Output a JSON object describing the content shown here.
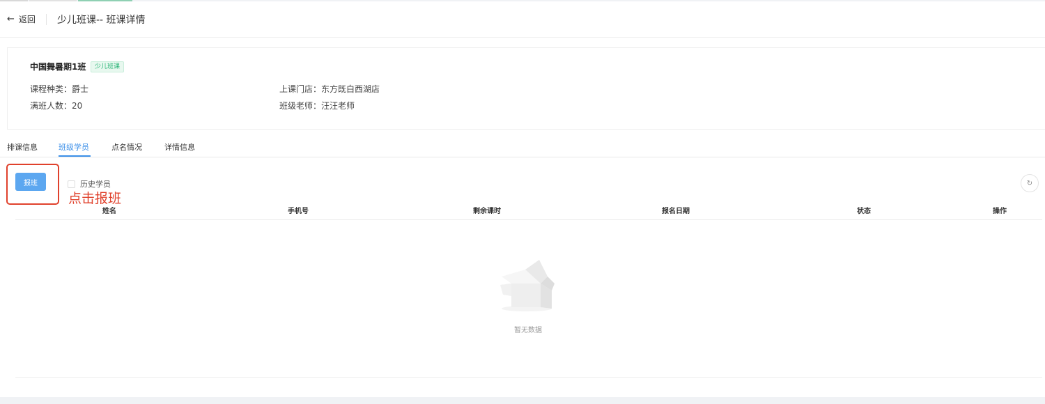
{
  "header": {
    "back_label": "返回",
    "title": "少儿班课-- 班课详情"
  },
  "class_info": {
    "name": "中国舞暑期1班",
    "tag": "少儿班课",
    "course_type": "课程种类：爵士",
    "capacity": "满班人数：20",
    "store": "上课门店：东方既白西湖店",
    "teacher": "班级老师：汪汪老师"
  },
  "tabs": [
    {
      "label": "排课信息",
      "active": false
    },
    {
      "label": "班级学员",
      "active": true
    },
    {
      "label": "点名情况",
      "active": false
    },
    {
      "label": "详情信息",
      "active": false
    }
  ],
  "toolbar": {
    "enroll_label": "报班",
    "history_label": "历史学员",
    "history_checked": false,
    "annotation": "点击报班",
    "refresh_icon": "refresh-icon"
  },
  "table": {
    "columns": [
      "姓名",
      "手机号",
      "剩余课时",
      "报名日期",
      "状态",
      "操作"
    ],
    "rows": [],
    "empty_text": "暂无数据"
  },
  "colors": {
    "accent": "#3b8fe8",
    "button": "#5ca7f0",
    "tag": "#2fb67a",
    "annotation": "#e0412c"
  }
}
